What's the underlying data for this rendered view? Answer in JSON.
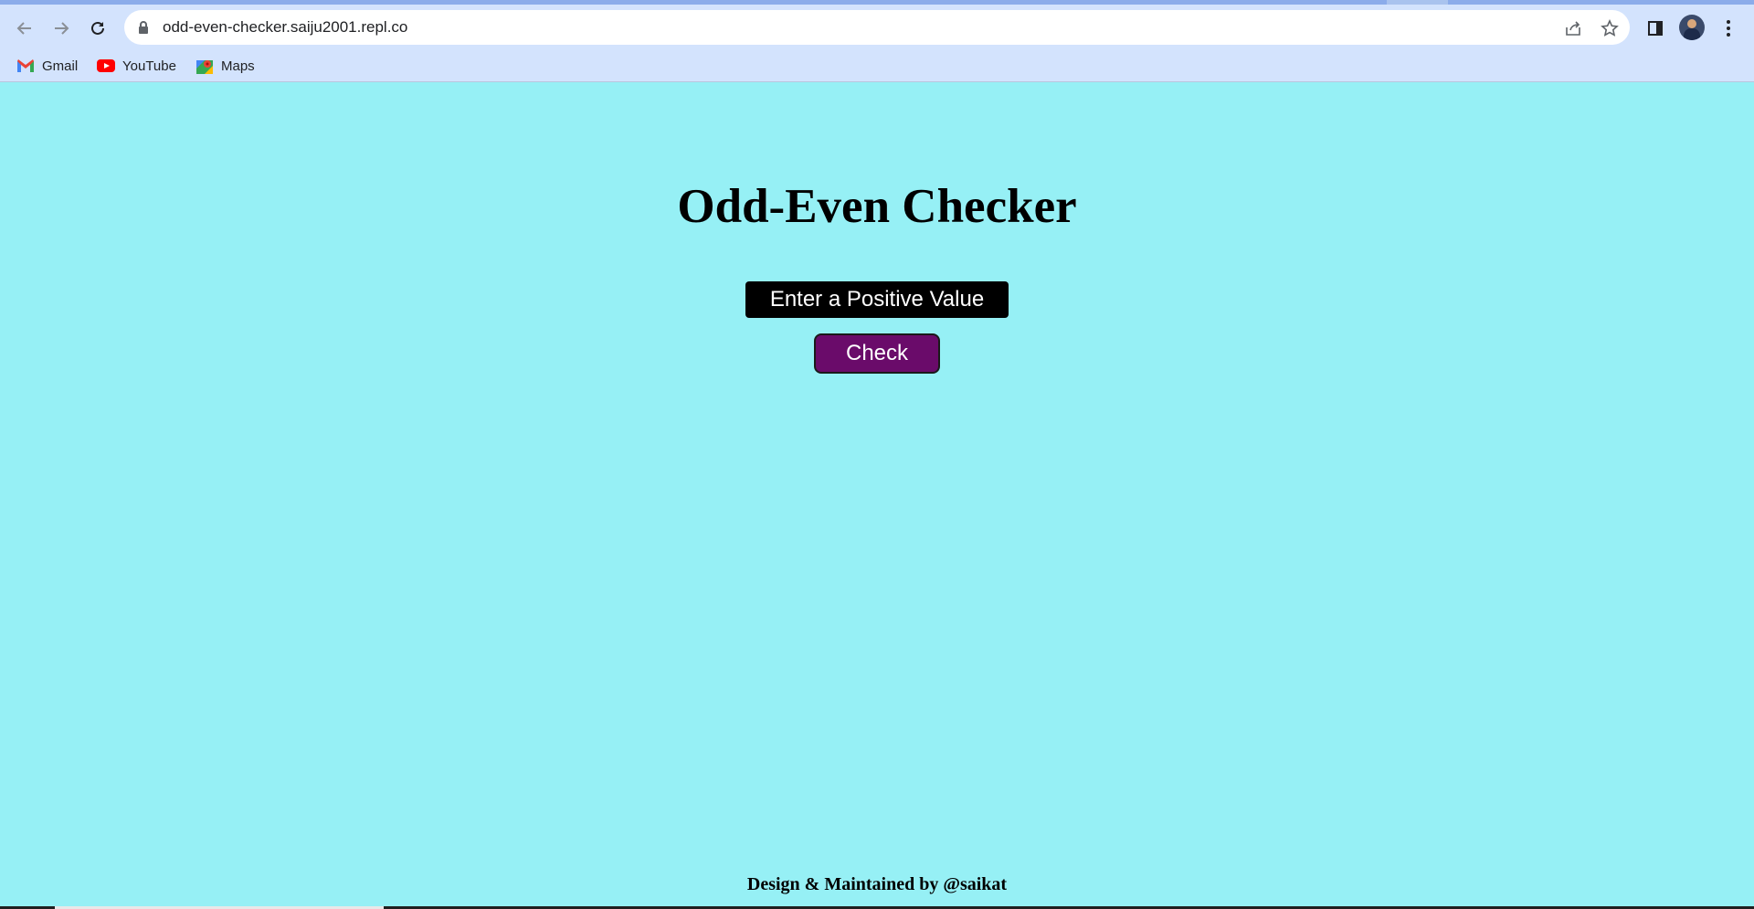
{
  "browser": {
    "url": "odd-even-checker.saiju2001.repl.co",
    "nav": {
      "back_icon": "back-arrow-icon",
      "forward_icon": "forward-arrow-icon",
      "reload_icon": "reload-icon"
    },
    "bookmarks": [
      {
        "label": "Gmail",
        "icon": "gmail-icon"
      },
      {
        "label": "YouTube",
        "icon": "youtube-icon"
      },
      {
        "label": "Maps",
        "icon": "maps-icon"
      }
    ]
  },
  "page": {
    "background_color": "#96f0f5",
    "title": "Odd-Even Checker",
    "input": {
      "placeholder": "Enter a Positive Value",
      "value": ""
    },
    "check_button_label": "Check",
    "check_button_color": "#6a0b6a",
    "footer": "Design & Maintained by @saikat"
  }
}
